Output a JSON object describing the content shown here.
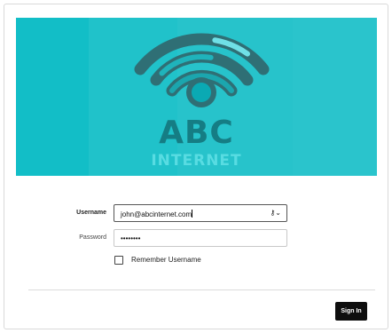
{
  "brand": {
    "name": "ABC",
    "sub": "INTERNET",
    "banner_color": "#12bec7",
    "logo_icon": "wifi-icon"
  },
  "form": {
    "username_label": "Username",
    "username_value": "john@abcinternet.com",
    "autofill_icon": "key-dropdown-icon",
    "autofill_glyph": "⚷⌄",
    "password_label": "Password",
    "password_mask": "••••••••",
    "remember_label": "Remember Username",
    "remember_checked": false
  },
  "actions": {
    "signin_label": "Sign In"
  }
}
